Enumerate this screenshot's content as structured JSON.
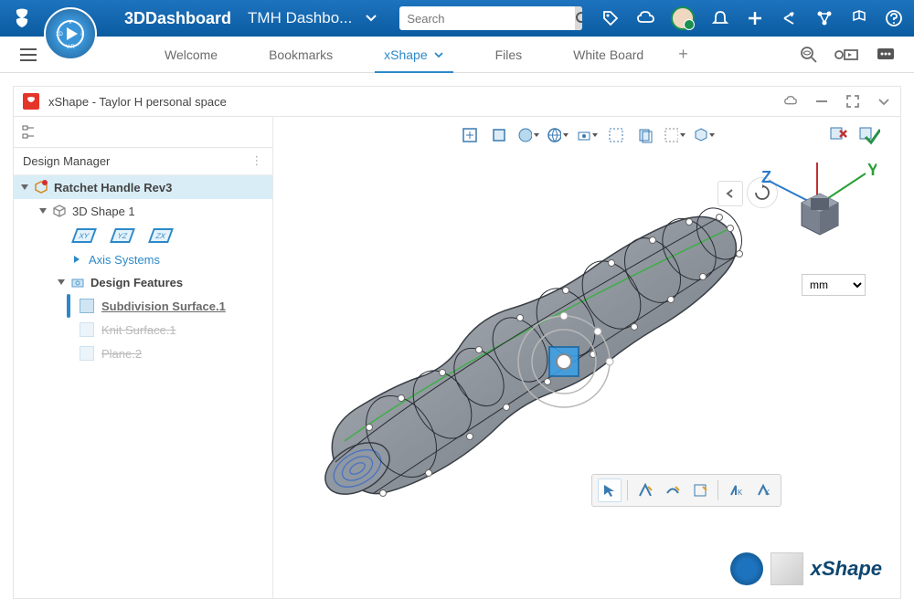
{
  "header": {
    "brand": "3DDashboard",
    "dashboard_name": "TMH Dashbo..."
  },
  "search": {
    "placeholder": "Search"
  },
  "tabs": [
    {
      "label": "Welcome",
      "active": false
    },
    {
      "label": "Bookmarks",
      "active": false
    },
    {
      "label": "xShape",
      "active": true
    },
    {
      "label": "Files",
      "active": false
    },
    {
      "label": "White Board",
      "active": false
    }
  ],
  "panel": {
    "title": "xShape - Taylor H personal space"
  },
  "design_manager": {
    "title": "Design Manager",
    "root": "Ratchet Handle Rev3",
    "shape": "3D Shape 1",
    "planes": [
      "XY",
      "YZ",
      "ZX"
    ],
    "axis_link": "Axis Systems",
    "design_features_label": "Design Features",
    "features": [
      {
        "name": "Subdivision Surface.1",
        "active": true
      },
      {
        "name": "Knit Surface.1",
        "active": false
      },
      {
        "name": "Plane.2",
        "active": false
      }
    ]
  },
  "viewport": {
    "axes": {
      "y": "Y",
      "z": "Z"
    },
    "unit": "mm"
  },
  "branding": {
    "app": "xShape"
  }
}
